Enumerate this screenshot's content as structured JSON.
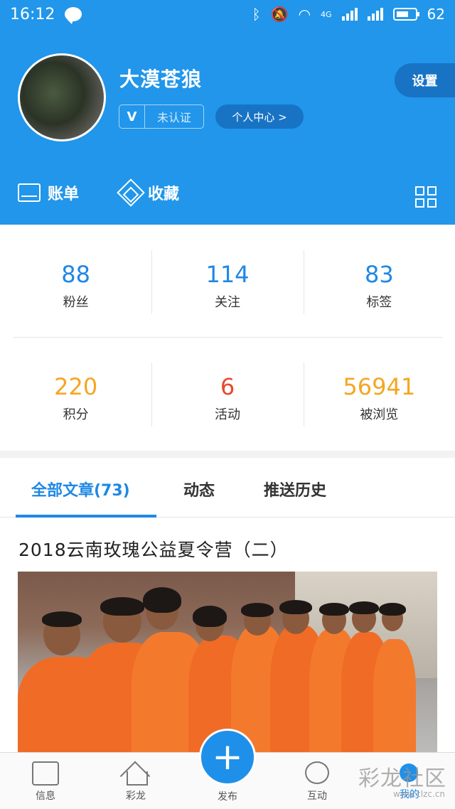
{
  "status_bar": {
    "time": "16:12",
    "network": "4G",
    "battery": "62"
  },
  "profile": {
    "username": "大漠苍狼",
    "verify_badge": "V",
    "verify_status": "未认证",
    "center_link": "个人中心 >",
    "settings": "设置"
  },
  "quick_actions": {
    "bill": "账单",
    "favorites": "收藏"
  },
  "stats": [
    {
      "value": "88",
      "label": "粉丝",
      "color": "#1e88e5"
    },
    {
      "value": "114",
      "label": "关注",
      "color": "#1e88e5"
    },
    {
      "value": "83",
      "label": "标签",
      "color": "#1e88e5"
    },
    {
      "value": "220",
      "label": "积分",
      "color": "#f5a623"
    },
    {
      "value": "6",
      "label": "活动",
      "color": "#e8482c"
    },
    {
      "value": "56941",
      "label": "被浏览",
      "color": "#f5a623"
    }
  ],
  "tabs": [
    {
      "label": "全部文章(73)",
      "active": true
    },
    {
      "label": "动态",
      "active": false
    },
    {
      "label": "推送历史",
      "active": false
    }
  ],
  "article": {
    "title": "2018云南玫瑰公益夏令营（二）"
  },
  "bottom_nav": {
    "items": [
      {
        "label": "信息",
        "icon": "message-icon"
      },
      {
        "label": "彩龙",
        "icon": "home-icon"
      },
      {
        "label": "发布",
        "icon": "plus-icon"
      },
      {
        "label": "互动",
        "icon": "chat-icon"
      },
      {
        "label": "我的",
        "icon": "user-icon"
      }
    ],
    "publish_symbol": "+"
  },
  "watermark": {
    "text": "彩龙社区",
    "url": "www.clzc.cn"
  }
}
